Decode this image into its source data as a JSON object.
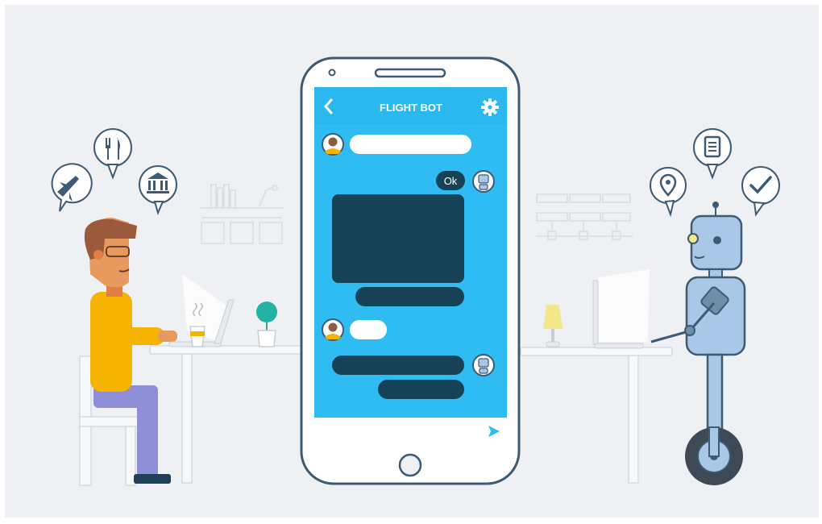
{
  "app": {
    "title": "FLIGHT BOT",
    "back_icon": "chevron-left-icon",
    "settings_icon": "gear-icon",
    "send_icon": "send-icon"
  },
  "chat": {
    "reply_label": "Ok",
    "messages": [
      {
        "sender": "user",
        "kind": "short-bar"
      },
      {
        "sender": "bot",
        "kind": "ok-reply"
      },
      {
        "sender": "bot",
        "kind": "card"
      },
      {
        "sender": "user",
        "kind": "small-bar"
      },
      {
        "sender": "bot",
        "kind": "bar"
      }
    ]
  },
  "user_thoughts": [
    "plane-icon",
    "fork-knife-icon",
    "bank-icon"
  ],
  "bot_thoughts": [
    "location-pin-icon",
    "document-icon",
    "checkmark-icon"
  ],
  "colors": {
    "background": "#eef0f3",
    "phone_screen": "#2fbcf2",
    "phone_header": "#29b3ea",
    "dark_bubble": "#164257",
    "line": "#dfe3e8",
    "human_shirt": "#f6b400",
    "human_pants": "#8e8fd6",
    "robot_body": "#a9c7e6"
  }
}
